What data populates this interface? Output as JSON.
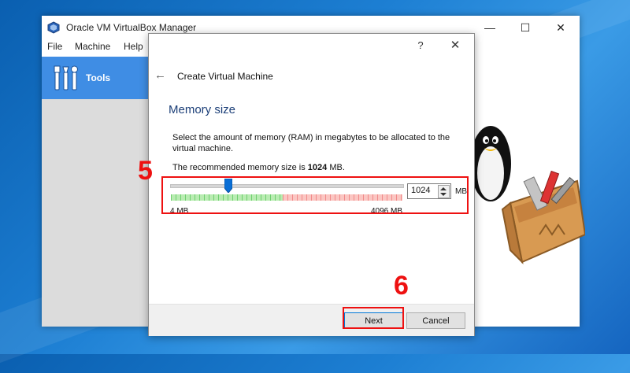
{
  "main_window": {
    "title": "Oracle VM VirtualBox Manager",
    "controls": {
      "minimize": "—",
      "maximize": "☐",
      "close": "✕"
    },
    "menu": [
      "File",
      "Machine",
      "Help"
    ],
    "tools_label": "Tools"
  },
  "dialog": {
    "help": "?",
    "close": "✕",
    "back": "←",
    "wizard_title": "Create Virtual Machine",
    "section_title": "Memory size",
    "description": "Select the amount of memory (RAM) in megabytes to be allocated to the virtual machine.",
    "recommend_prefix": "The recommended memory size is ",
    "recommend_value": "1024",
    "recommend_suffix": " MB.",
    "memory": {
      "value": "1024",
      "unit": "MB",
      "min_label": "4 MB",
      "max_label": "4096 MB",
      "slider_fraction": 0.25
    },
    "buttons": {
      "next": "Next",
      "cancel": "Cancel"
    }
  },
  "annotations": {
    "step5": "5",
    "step6": "6"
  },
  "colors": {
    "accent": "#3f8de4",
    "annotation": "#e11111",
    "section_title": "#1c3f78"
  },
  "icons": [
    "virtualbox-logo-icon",
    "tools-icon",
    "back-arrow-icon",
    "help-icon",
    "close-icon",
    "spin-up-icon",
    "spin-down-icon",
    "slider-thumb-icon",
    "penguin-toolbox-icon"
  ]
}
